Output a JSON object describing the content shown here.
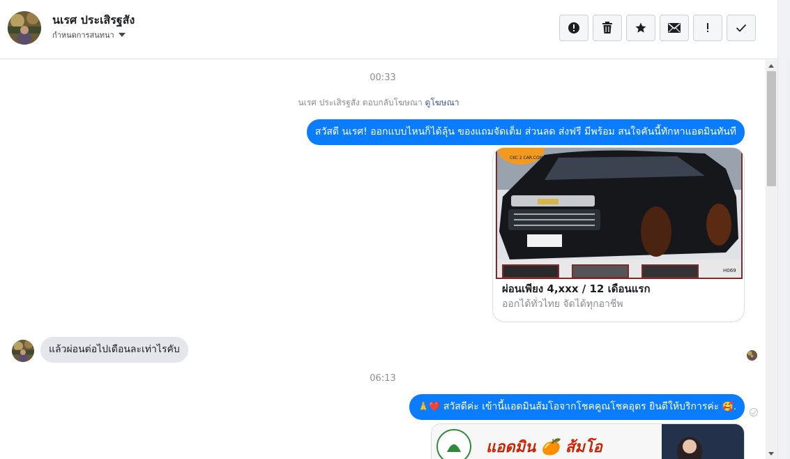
{
  "header": {
    "name": "นเรศ ประเสิรฐสัง",
    "subtitle": "กำหนดการสนทนา",
    "actions": [
      {
        "name": "report-button",
        "icon": "exclamation-circle-icon"
      },
      {
        "name": "delete-button",
        "icon": "trash-icon"
      },
      {
        "name": "star-button",
        "icon": "star-icon"
      },
      {
        "name": "mark-unread-button",
        "icon": "envelope-icon"
      },
      {
        "name": "spam-button",
        "icon": "exclamation-icon"
      },
      {
        "name": "done-button",
        "icon": "checkmark-icon"
      }
    ]
  },
  "conversation": {
    "timestamp_1": "00:33",
    "reply_note": "นเรศ ประเสิรฐสัง ตอบกลับโฆษณา",
    "reply_link": "ดูโฆษณา",
    "message_1": "สวัสดี นเรศ! ออกแบบไหนก็ได้ลุ้น ของแถมจัดเต็ม ส่วนลด ส่งฟรี มีพร้อม สนใจคันนี้ทักหาแอดมินทันที",
    "card": {
      "title": "ผ่อนเพียง 4,xxx / 12 เดือนแรก",
      "subtitle": "ออกได้ทั่วไทย จัดได้ทุกอาชีพ",
      "logo_text": "CKC 2 CAR.COM",
      "tag": "H069"
    },
    "incoming_message": "แล้วผ่อนต่อไปเดือนละเท่าไรคับ",
    "timestamp_2": "06:13",
    "message_2_emoji_prefix": "🙏❤️",
    "message_2": "สวัสดีค่ะ เข้านี้แอดมินส้มโอจากโชคคูณโชคอุดร ยินดีให้บริการค่ะ",
    "message_2_emoji_suffix": "🥰.",
    "banner_text": "แอดมิน 🍊 ส้มโอ"
  },
  "colors": {
    "outgoing_bubble": "#0a7cff",
    "incoming_bubble": "#e4e6eb",
    "link": "#385898"
  }
}
